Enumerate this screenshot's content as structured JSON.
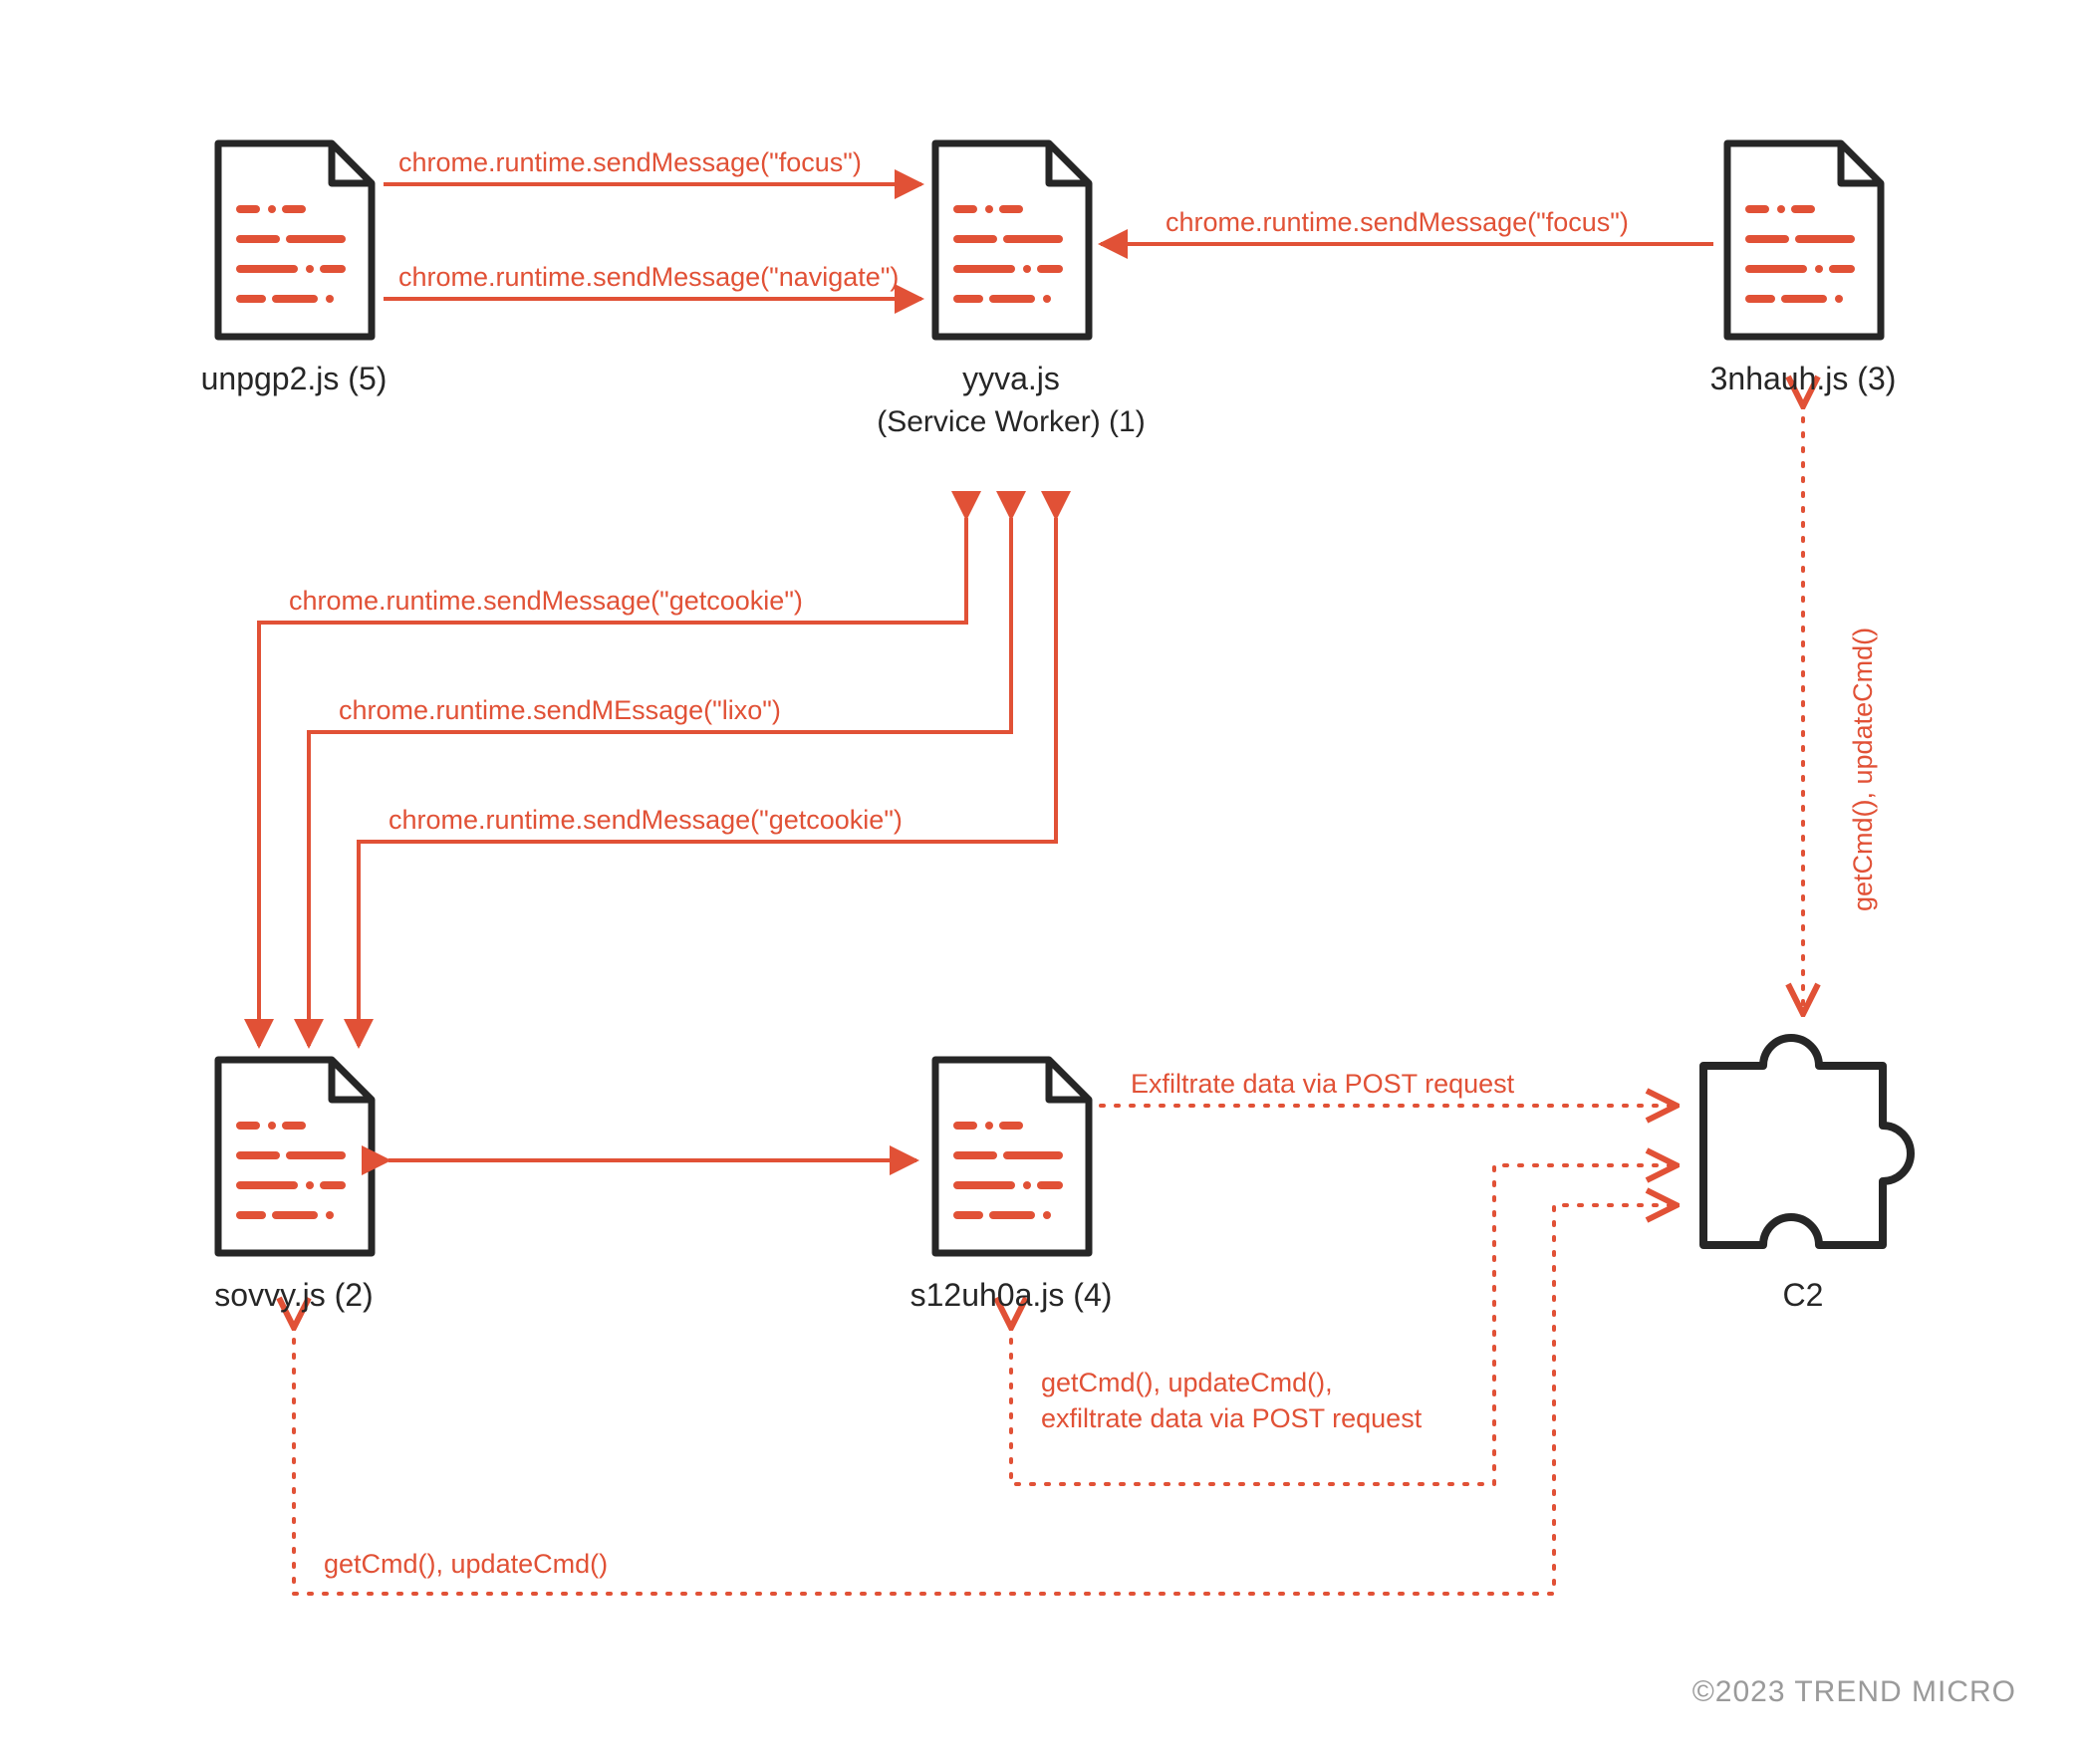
{
  "nodes": {
    "unpgp2": {
      "label": "unpgp2.js (5)"
    },
    "yyva": {
      "label": "yyva.js",
      "sub": "(Service Worker) (1)"
    },
    "nhauh": {
      "label": "3nhauh.js (3)"
    },
    "sovvy": {
      "label": "sovvy.js (2)"
    },
    "s12uh0a": {
      "label": "s12uh0a.js (4)"
    },
    "c2": {
      "label": "C2"
    }
  },
  "edges": {
    "focus1": "chrome.runtime.sendMessage(\"focus\")",
    "navigate": "chrome.runtime.sendMessage(\"navigate\")",
    "focus2": "chrome.runtime.sendMessage(\"focus\")",
    "getcookie1": "chrome.runtime.sendMessage(\"getcookie\")",
    "lixo": "chrome.runtime.sendMEssage(\"lixo\")",
    "getcookie2": "chrome.runtime.sendMessage(\"getcookie\")",
    "exfil": "Exfiltrate data via POST request",
    "s12_c2": "getCmd(), updateCmd(),\nexfiltrate data via POST request",
    "sovvy_c2": "getCmd(), updateCmd()",
    "nhauh_c2": "getCmd(), updateCmd()"
  },
  "copyright": "©2023 TREND MICRO"
}
